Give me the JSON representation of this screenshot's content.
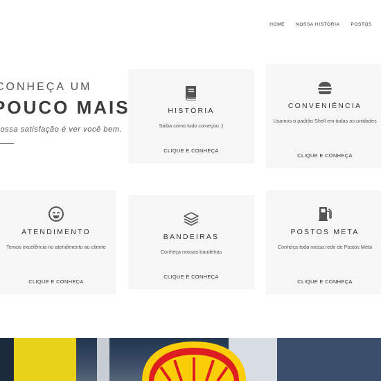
{
  "nav": {
    "items": [
      "HOME",
      "NOSSA HISTÓRIA",
      "POSTOS"
    ]
  },
  "hero": {
    "line1": "CONHEÇA UM",
    "line2": "POUCO MAIS",
    "tagline": "Nossa satisfação é ver você bem."
  },
  "cards": [
    {
      "title": "HISTÓRIA",
      "desc": "Saiba como tudo começou :)",
      "cta": "CLIQUE E CONHEÇA",
      "icon": "book-icon"
    },
    {
      "title": "CONVENIÊNCIA",
      "desc": "Usamos o padrão Shell em todas as unidades",
      "cta": "CLIQUE E CONHEÇA",
      "icon": "burger-icon"
    },
    {
      "title": "ATENDIMENTO",
      "desc": "Temos excelência no atendimento ao cliente",
      "cta": "CLIQUE E CONHEÇA",
      "icon": "smile-icon"
    },
    {
      "title": "BANDEIRAS",
      "desc": "Conheça nossas bandeiras",
      "cta": "CLIQUE E CONHEÇA",
      "icon": "layers-icon"
    },
    {
      "title": "POSTOS META",
      "desc": "Conheça toda nossa rede de Postos Meta",
      "cta": "CLIQUE E CONHEÇA",
      "icon": "gas-pump-icon"
    }
  ],
  "colors": {
    "card_bg": "#f6f6f6",
    "icon": "#555555",
    "shell_red": "#dd1d21",
    "shell_yellow": "#fbce07"
  }
}
